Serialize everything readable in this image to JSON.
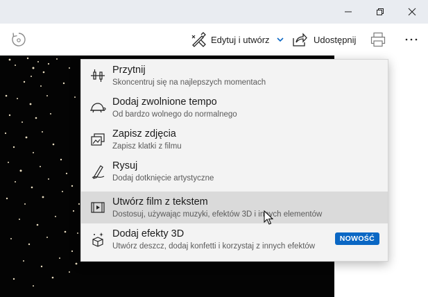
{
  "toolbar": {
    "edit_create_label": "Edytuj i utwórz",
    "share_label": "Udostępnij"
  },
  "menu": {
    "items": [
      {
        "title": "Przytnij",
        "desc": "Skoncentruj się na najlepszych momentach",
        "icon": "trim-icon"
      },
      {
        "title": "Dodaj zwolnione tempo",
        "desc": "Od bardzo wolnego do normalnego",
        "icon": "turtle-icon"
      },
      {
        "title": "Zapisz zdjęcia",
        "desc": "Zapisz klatki z filmu",
        "icon": "save-frames-icon"
      },
      {
        "title": "Rysuj",
        "desc": "Dodaj dotknięcie artystyczne",
        "icon": "draw-icon"
      },
      {
        "title": "Utwórz film z tekstem",
        "desc": "Dostosuj, używając muzyki, efektów 3D i innych elementów",
        "icon": "video-text-icon"
      },
      {
        "title": "Dodaj efekty 3D",
        "desc": "Utwórz deszcz, dodaj konfetti i korzystaj z innych efektów",
        "icon": "effects-3d-icon",
        "badge": "NOWOŚĆ"
      }
    ]
  },
  "colors": {
    "accent": "#0a67c4",
    "menu_bg": "#f3f3f3",
    "menu_hover": "#dadada",
    "titlebar": "#e9ecf1"
  }
}
